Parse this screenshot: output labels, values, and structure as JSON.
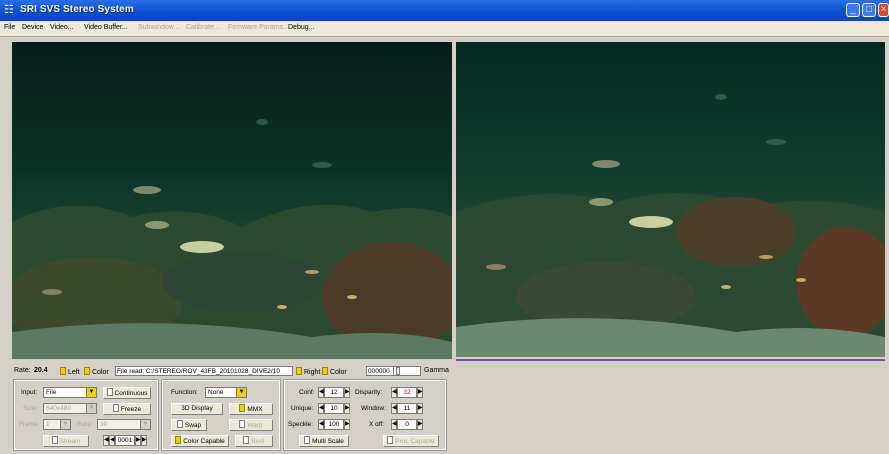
{
  "window": {
    "title": "SRI SVS Stereo System",
    "app_icon": "stereo-app-icon",
    "controls": [
      "minimize-icon",
      "maximize-icon",
      "close-icon"
    ]
  },
  "menu": [
    {
      "label": "File",
      "enabled": true
    },
    {
      "label": "Device",
      "enabled": true
    },
    {
      "label": "Video...",
      "enabled": true
    },
    {
      "label": "Video Buffer...",
      "enabled": true
    },
    {
      "label": "Subwindow...",
      "enabled": false
    },
    {
      "label": "Calibrate...",
      "enabled": false
    },
    {
      "label": "Firmware Params...",
      "enabled": false
    },
    {
      "label": "Debug...",
      "enabled": true
    }
  ],
  "status": {
    "rate_label": "Rate:",
    "rate_value": "20.4",
    "left_label": "Left",
    "left_color_label": "Color",
    "file_read": "File read: C:/STEREO/ROV_43FB_20101028_DIVE2/10",
    "right_label": "Right",
    "right_color_label": "Color",
    "color_hex": "000000",
    "gamma_label": "Gamma"
  },
  "input_panel": {
    "input_label": "Input:",
    "input_value": "File",
    "continuous_label": "Continuous",
    "size_label": "Size:",
    "size_value": "640x480",
    "freeze_label": "Freeze",
    "frame_label": "Frame:",
    "frame_value": "1",
    "rate_label": "Rate:",
    "rate_value": "30",
    "stream_label": "Stream",
    "frame_counter": "0001"
  },
  "function_panel": {
    "function_label": "Function:",
    "function_value": "None",
    "display_3d_label": "3D Display",
    "mmx_label": "MMX",
    "swap_label": "Swap",
    "warp_label": "Warp",
    "color_capable_label": "Color Capable",
    "best_label": "Best"
  },
  "params_panel": {
    "conf_label": "Conf:",
    "conf_value": "12",
    "unique_label": "Unique:",
    "unique_value": "10",
    "speckle_label": "Speckle:",
    "speckle_value": "100",
    "disparity_label": "Disparity:",
    "disparity_value": "32",
    "window_label": "Window:",
    "window_value": "11",
    "xoff_label": "X off:",
    "xoff_value": "0",
    "multi_scale_label": "Multi Scale",
    "proc_capable_label": "Proc Capable"
  },
  "colors": {
    "accent_yellow": "#f0d000",
    "title_blue": "#0b4fd3",
    "disabled_text": "#a8a598",
    "disparity_text": "#d01010"
  }
}
